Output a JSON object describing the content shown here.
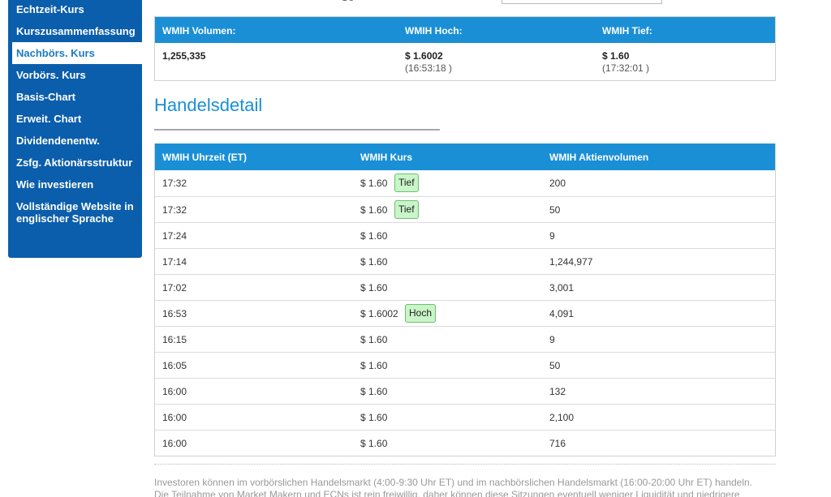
{
  "top_fragment": "Ge",
  "sidebar": {
    "items": [
      {
        "label": "Echtzeit-Kurs"
      },
      {
        "label": "Kurszusammenfassung"
      },
      {
        "label": "Nachbörs. Kurs"
      },
      {
        "label": "Vorbörs. Kurs"
      },
      {
        "label": "Basis-Chart"
      },
      {
        "label": "Erweit. Chart"
      },
      {
        "label": "Dividendenentw."
      },
      {
        "label": "Zsfg. Aktionärsstruktur"
      },
      {
        "label": "Wie investieren"
      },
      {
        "label": "Vollständige Website in englischer Sprache"
      }
    ],
    "active_index": 2
  },
  "summary": {
    "headers": {
      "volume": "WMIH Volumen:",
      "high": "WMIH Hoch:",
      "low": "WMIH Tief:"
    },
    "volume": "1,255,335",
    "high": {
      "value": "$ 1.6002",
      "time": "(16:53:18 )"
    },
    "low": {
      "value": "$ 1.60",
      "time": "(17:32:01 )"
    }
  },
  "detail": {
    "title": "Handelsdetail",
    "columns": [
      "WMIH Uhrzeit (ET)",
      "WMIH Kurs",
      "WMIH Aktienvolumen"
    ],
    "rows": [
      {
        "time": "17:32",
        "price": "$ 1.60",
        "badge": "Tief",
        "volume": "200"
      },
      {
        "time": "17:32",
        "price": "$ 1.60",
        "badge": "Tief",
        "volume": "50"
      },
      {
        "time": "17:24",
        "price": "$ 1.60",
        "badge": "",
        "volume": "9"
      },
      {
        "time": "17:14",
        "price": "$ 1.60",
        "badge": "",
        "volume": "1,244,977"
      },
      {
        "time": "17:02",
        "price": "$ 1.60",
        "badge": "",
        "volume": "3,001"
      },
      {
        "time": "16:53",
        "price": "$ 1.6002",
        "badge": "Hoch",
        "volume": "4,091"
      },
      {
        "time": "16:15",
        "price": "$ 1.60",
        "badge": "",
        "volume": "9"
      },
      {
        "time": "16:05",
        "price": "$ 1.60",
        "badge": "",
        "volume": "50"
      },
      {
        "time": "16:00",
        "price": "$ 1.60",
        "badge": "",
        "volume": "132"
      },
      {
        "time": "16:00",
        "price": "$ 1.60",
        "badge": "",
        "volume": "2,100"
      },
      {
        "time": "16:00",
        "price": "$ 1.60",
        "badge": "",
        "volume": "716"
      }
    ]
  },
  "footnote": {
    "line1": "Investoren können im vorbörslichen Handelsmarkt (4:00-9:30 Uhr ET) und im nachbörslichen Handelsmarkt (16:00-20:00 Uhr ET) handeln.",
    "line2": "Die Teilnahme von Market Makern und ECNs ist rein freiwillig, daher können diese Sitzungen eventuell weniger Liquidität und niedrigere"
  },
  "colors": {
    "sidebar_bg": "#0b5eab",
    "header_bg": "#1a8fd6",
    "title": "#1a8fd6",
    "badge_bg": "#c9f5c9",
    "badge_border": "#6fbf6f"
  }
}
